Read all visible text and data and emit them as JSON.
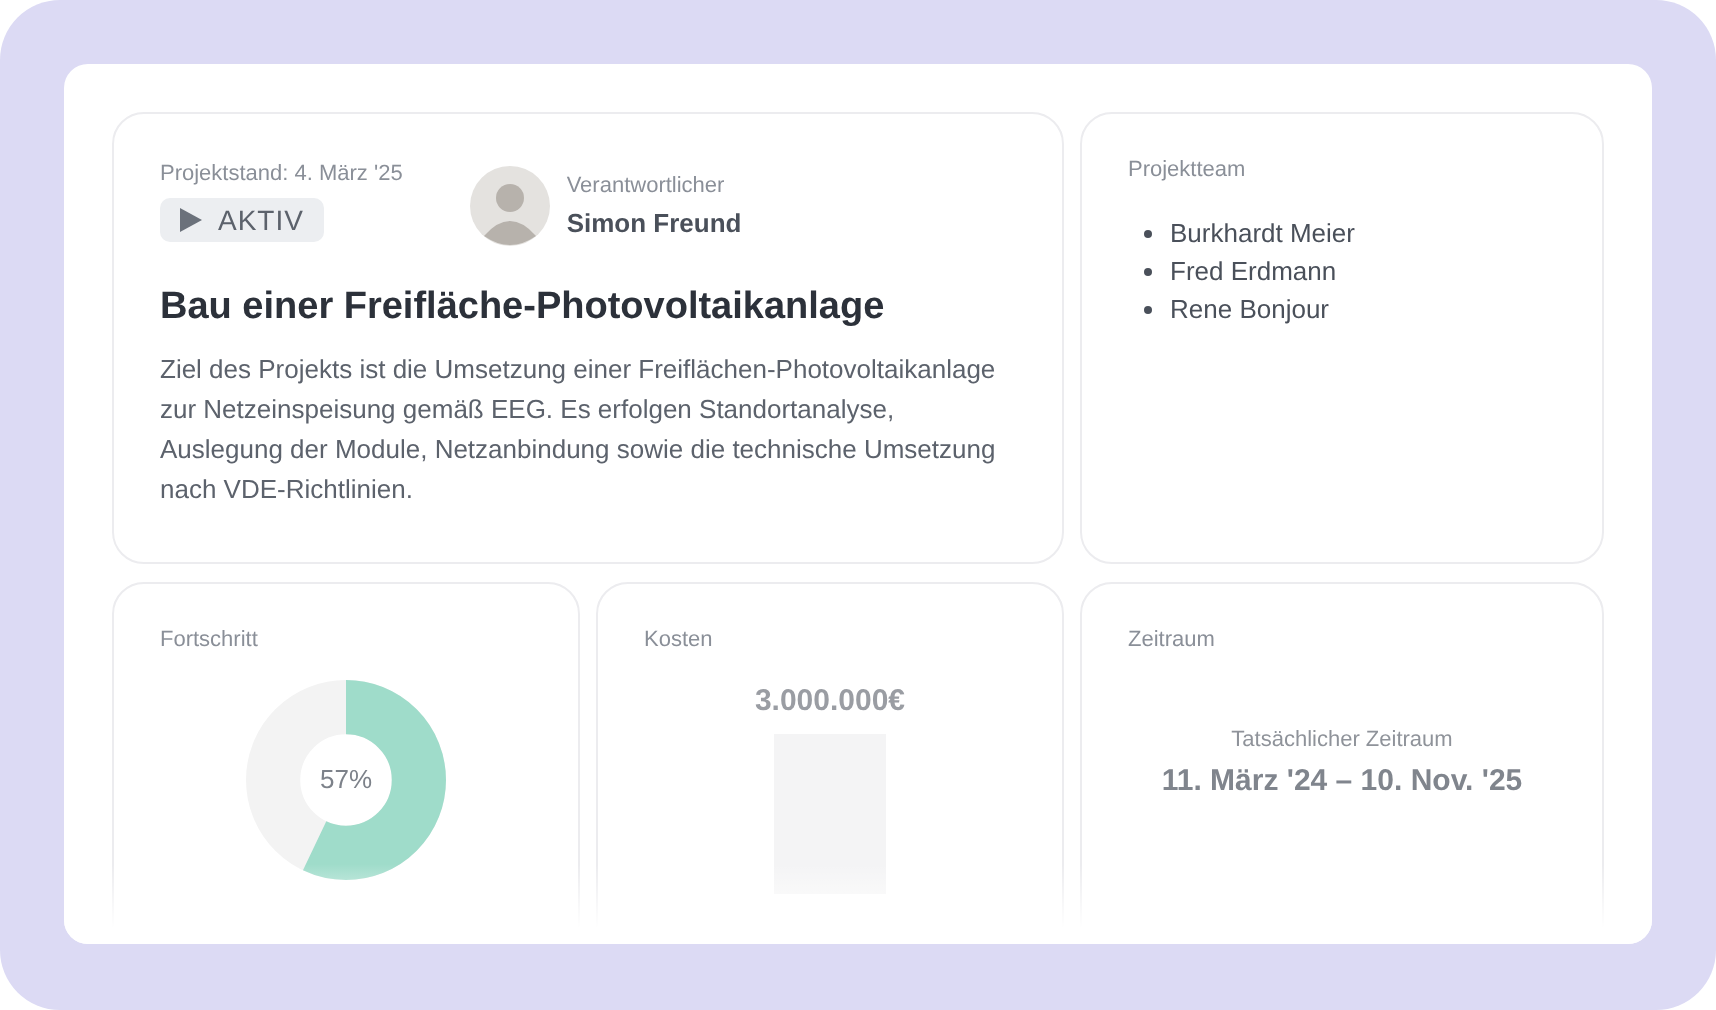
{
  "project": {
    "status_date": "Projektstand: 4. März '25",
    "status": "AKTIV",
    "owner_label": "Verantwortlicher",
    "owner_name": "Simon Freund",
    "title": "Bau einer Freifläche-Photovoltaikanlage",
    "description": "Ziel des Projekts ist die Umsetzung einer Freiflächen-Photovoltaikanlage zur Netzeinspeisung gemäß EEG. Es erfolgen Standortanalyse, Auslegung der Module, Netzanbindung sowie die technische Umsetzung nach VDE-Richtlinien."
  },
  "team": {
    "title": "Projektteam",
    "members": [
      "Burkhardt Meier",
      "Fred Erdmann",
      "Rene Bonjour"
    ]
  },
  "progress": {
    "title": "Fortschritt",
    "level": 0.57,
    "reading": "57%"
  },
  "costs": {
    "title": "Kosten",
    "amount": "3.000.000€"
  },
  "period": {
    "title": "Zeitraum",
    "label": "Tatsächlicher Zeitraum",
    "range": "11. März '24 – 10. Nov. '25"
  }
}
